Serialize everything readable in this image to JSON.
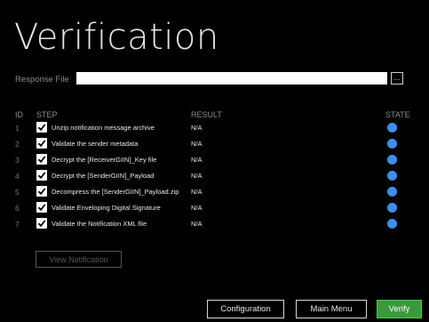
{
  "title": "Verification",
  "response_file": {
    "label": "Response File",
    "value": "",
    "browse_label": "..."
  },
  "table": {
    "headers": {
      "id": "ID",
      "step": "STEP",
      "result": "RESULT",
      "state": "STATE"
    },
    "rows": [
      {
        "id": "1",
        "step": "Unzip notification message archive",
        "result": "N/A",
        "checked": true,
        "state_color": "#3a8ef0"
      },
      {
        "id": "2",
        "step": "Validate the sender metadata",
        "result": "N/A",
        "checked": true,
        "state_color": "#3a8ef0"
      },
      {
        "id": "3",
        "step": "Decrypt the [ReceiverGIIN]_Key file",
        "result": "N/A",
        "checked": true,
        "state_color": "#3a8ef0"
      },
      {
        "id": "4",
        "step": "Decrypt the [SenderGIIN]_Payload",
        "result": "N/A",
        "checked": true,
        "state_color": "#3a8ef0"
      },
      {
        "id": "5",
        "step": "Decompress the [SenderGIIN]_Payload.zip",
        "result": "N/A",
        "checked": true,
        "state_color": "#3a8ef0"
      },
      {
        "id": "6",
        "step": "Validate Enveloping Digital Signature",
        "result": "N/A",
        "checked": true,
        "state_color": "#3a8ef0"
      },
      {
        "id": "7",
        "step": "Validate the Notification XML file",
        "result": "N/A",
        "checked": true,
        "state_color": "#3a8ef0"
      }
    ]
  },
  "buttons": {
    "view_notification": "View Notification",
    "configuration": "Configuration",
    "main_menu": "Main Menu",
    "verify": "Verify"
  },
  "colors": {
    "accent_blue": "#3a8ef0",
    "verify_green": "#3a9a3a"
  }
}
